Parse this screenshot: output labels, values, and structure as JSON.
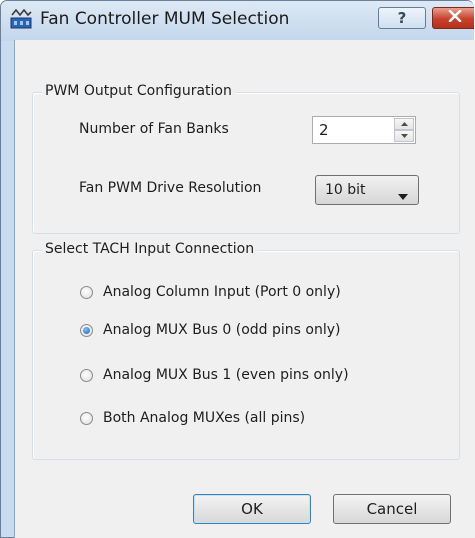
{
  "window": {
    "title": "Fan Controller MUM Selection",
    "help_label": "?",
    "icons": {
      "app": "fan-controller-icon",
      "help": "help-icon",
      "close": "close-icon"
    }
  },
  "pwm_group": {
    "title": "PWM Output Configuration",
    "fan_banks_label": "Number of Fan Banks",
    "fan_banks_value": "2",
    "resolution_label": "Fan PWM Drive Resolution",
    "resolution_value": "10 bit"
  },
  "tach_group": {
    "title": "Select TACH Input Connection",
    "options": [
      {
        "label": "Analog Column Input (Port 0 only)",
        "selected": false
      },
      {
        "label": "Analog MUX Bus 0 (odd pins only)",
        "selected": true
      },
      {
        "label": "Analog MUX Bus 1 (even pins only)",
        "selected": false
      },
      {
        "label": "Both Analog MUXes (all pins)",
        "selected": false
      }
    ]
  },
  "buttons": {
    "ok": "OK",
    "cancel": "Cancel"
  },
  "colors": {
    "close_button": "#c7402a",
    "radio_selected": "#1a5fb8",
    "frame": "#c9dbef"
  }
}
